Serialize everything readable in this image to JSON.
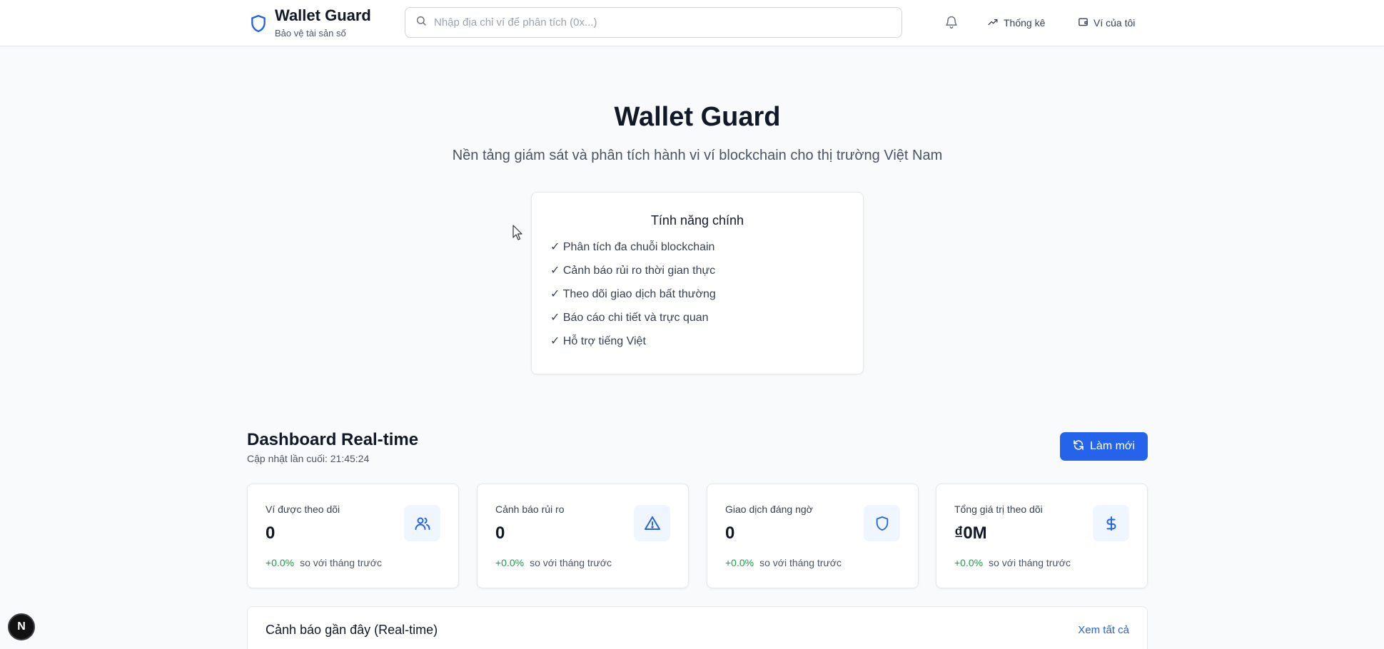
{
  "header": {
    "brand_title": "Wallet Guard",
    "brand_subtitle": "Bảo vệ tài sản số",
    "search_placeholder": "Nhập địa chỉ ví để phân tích (0x...)",
    "nav": {
      "stats_label": "Thống kê",
      "wallet_label": "Ví của tôi"
    },
    "icons": [
      "shield-icon",
      "search-icon",
      "bell-icon",
      "trending-up-icon",
      "wallet-icon"
    ]
  },
  "hero": {
    "title": "Wallet Guard",
    "subtitle": "Nền tảng giám sát và phân tích hành vi ví blockchain cho thị trường Việt Nam",
    "features_title": "Tính năng chính",
    "features": [
      "✓ Phân tích đa chuỗi blockchain",
      "✓ Cảnh báo rủi ro thời gian thực",
      "✓ Theo dõi giao dịch bất thường",
      "✓ Báo cáo chi tiết và trực quan",
      "✓ Hỗ trợ tiếng Việt"
    ]
  },
  "dashboard": {
    "title": "Dashboard Real-time",
    "last_updated": "Cập nhật lần cuối: 21:45:24",
    "refresh_label": "Làm mới",
    "cards": [
      {
        "label": "Ví được theo dõi",
        "value": "0",
        "change": "+0.0%",
        "compare": "so với tháng trước",
        "icon": "users-icon"
      },
      {
        "label": "Cảnh báo rủi ro",
        "value": "0",
        "change": "+0.0%",
        "compare": "so với tháng trước",
        "icon": "alert-triangle-icon"
      },
      {
        "label": "Giao dịch đáng ngờ",
        "value": "0",
        "change": "+0.0%",
        "compare": "so với tháng trước",
        "icon": "shield-icon"
      },
      {
        "label": "Tổng giá trị theo dõi",
        "value": "₫0M",
        "change": "+0.0%",
        "compare": "so với tháng trước",
        "icon": "dollar-icon"
      }
    ],
    "alerts_title": "Cảnh báo gần đây (Real-time)",
    "alerts_link": "Xem tất cả"
  },
  "dev_badge": "N",
  "colors": {
    "accent": "#2563eb",
    "positive": "#16a34a",
    "icon_bg": "#eff6ff"
  }
}
